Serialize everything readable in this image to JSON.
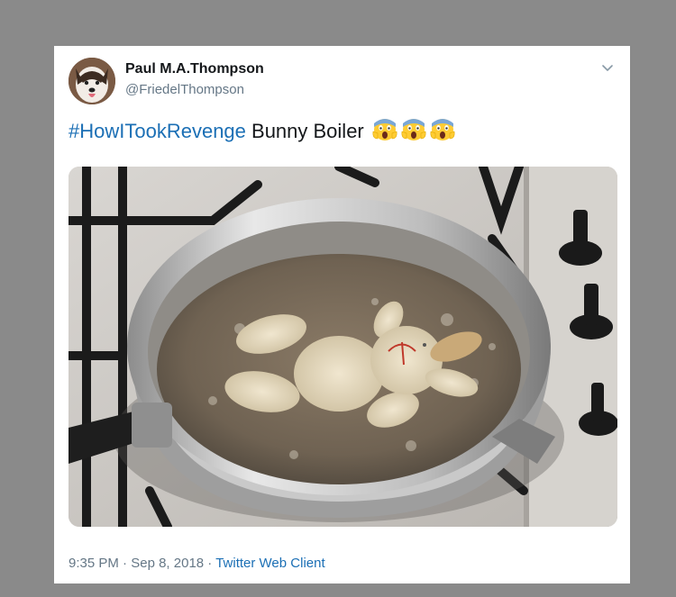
{
  "tweet": {
    "author_name": "Paul M.A.Thompson",
    "author_handle": "@FriedelThompson",
    "hashtag": "#HowITookRevenge",
    "text": " Bunny Boiler",
    "emoji": [
      "face-screaming-in-fear",
      "face-screaming-in-fear",
      "face-screaming-in-fear"
    ],
    "time": "9:35 PM",
    "separator": "·",
    "date": "Sep 8, 2018",
    "client": "Twitter Web Client"
  },
  "colors": {
    "link": "#1b6fb5",
    "name": "#14171a",
    "secondary": "#657786",
    "backdrop": "#8a8a8a"
  },
  "icons": {
    "menu": "chevron-down-icon",
    "avatar": "husky-dog-avatar"
  }
}
